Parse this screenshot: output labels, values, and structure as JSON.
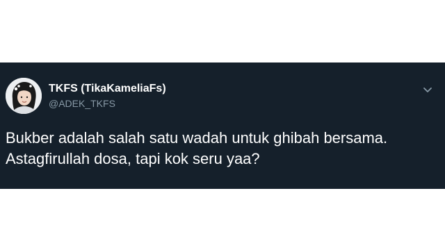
{
  "tweet": {
    "author": {
      "display_name": "TKFS (TikaKameliaFs)",
      "handle": "@ADEK_TKFS"
    },
    "text": "Bukber adalah salah satu wadah untuk ghibah bersama.\nAstagfirullah dosa, tapi kok seru yaa?",
    "menu_icon": "chevron-down-icon",
    "avatar_icon": "profile-photo"
  },
  "colors": {
    "background": "#15202b",
    "text_primary": "#ffffff",
    "text_secondary": "#8899a6",
    "page_background": "#ffffff"
  }
}
